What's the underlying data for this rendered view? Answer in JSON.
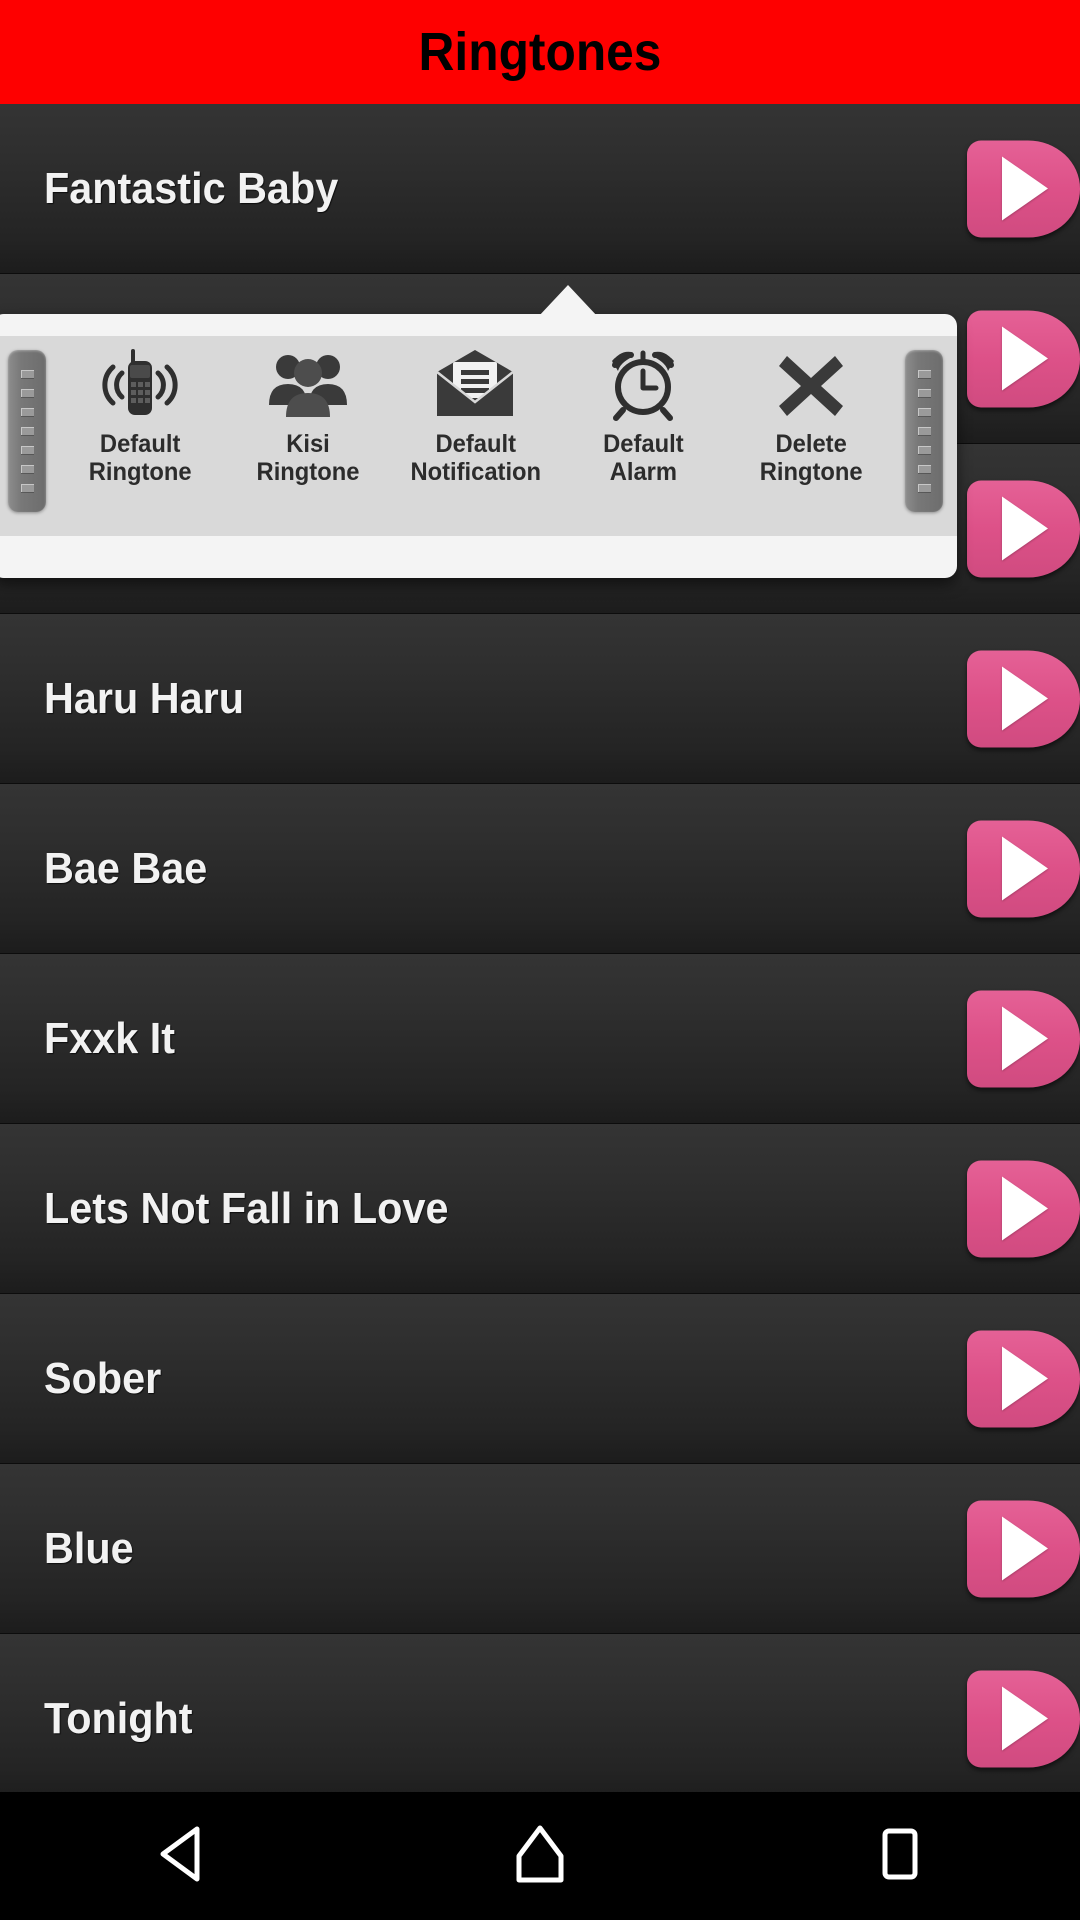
{
  "header": {
    "title": "Ringtones",
    "bg_color": "#fe0000",
    "text_color": "#000000"
  },
  "theme": {
    "accent_pink": "#dd5188",
    "list_bg": "#2d2d2d",
    "title_color": "#f2f2f2",
    "popup_frame": "#f4f4f4",
    "popup_panel": "#d9d9d9"
  },
  "list": {
    "play_button_label": "play-icon",
    "items": [
      {
        "title": "Fantastic Baby"
      },
      {
        "title": ""
      },
      {
        "title": ""
      },
      {
        "title": "Haru Haru"
      },
      {
        "title": "Bae Bae"
      },
      {
        "title": "Fxxk It"
      },
      {
        "title": "Lets Not Fall in Love"
      },
      {
        "title": "Sober"
      },
      {
        "title": "Blue"
      },
      {
        "title": "Tonight"
      }
    ]
  },
  "popup": {
    "visible": true,
    "grip_left": "drag-handle-left",
    "grip_right": "drag-handle-right",
    "items": [
      {
        "label": "Default\nRingtone",
        "icon": "vibrating-phone-icon"
      },
      {
        "label": "Kisi Ringtone",
        "icon": "contacts-group-icon"
      },
      {
        "label": "Default\nNotification",
        "icon": "envelope-icon"
      },
      {
        "label": "Default\nAlarm",
        "icon": "alarm-clock-icon"
      },
      {
        "label": "Delete\nRingtone",
        "icon": "close-x-icon"
      }
    ]
  },
  "navbar": {
    "back": "back-icon",
    "home": "home-icon",
    "recents": "recents-icon"
  }
}
